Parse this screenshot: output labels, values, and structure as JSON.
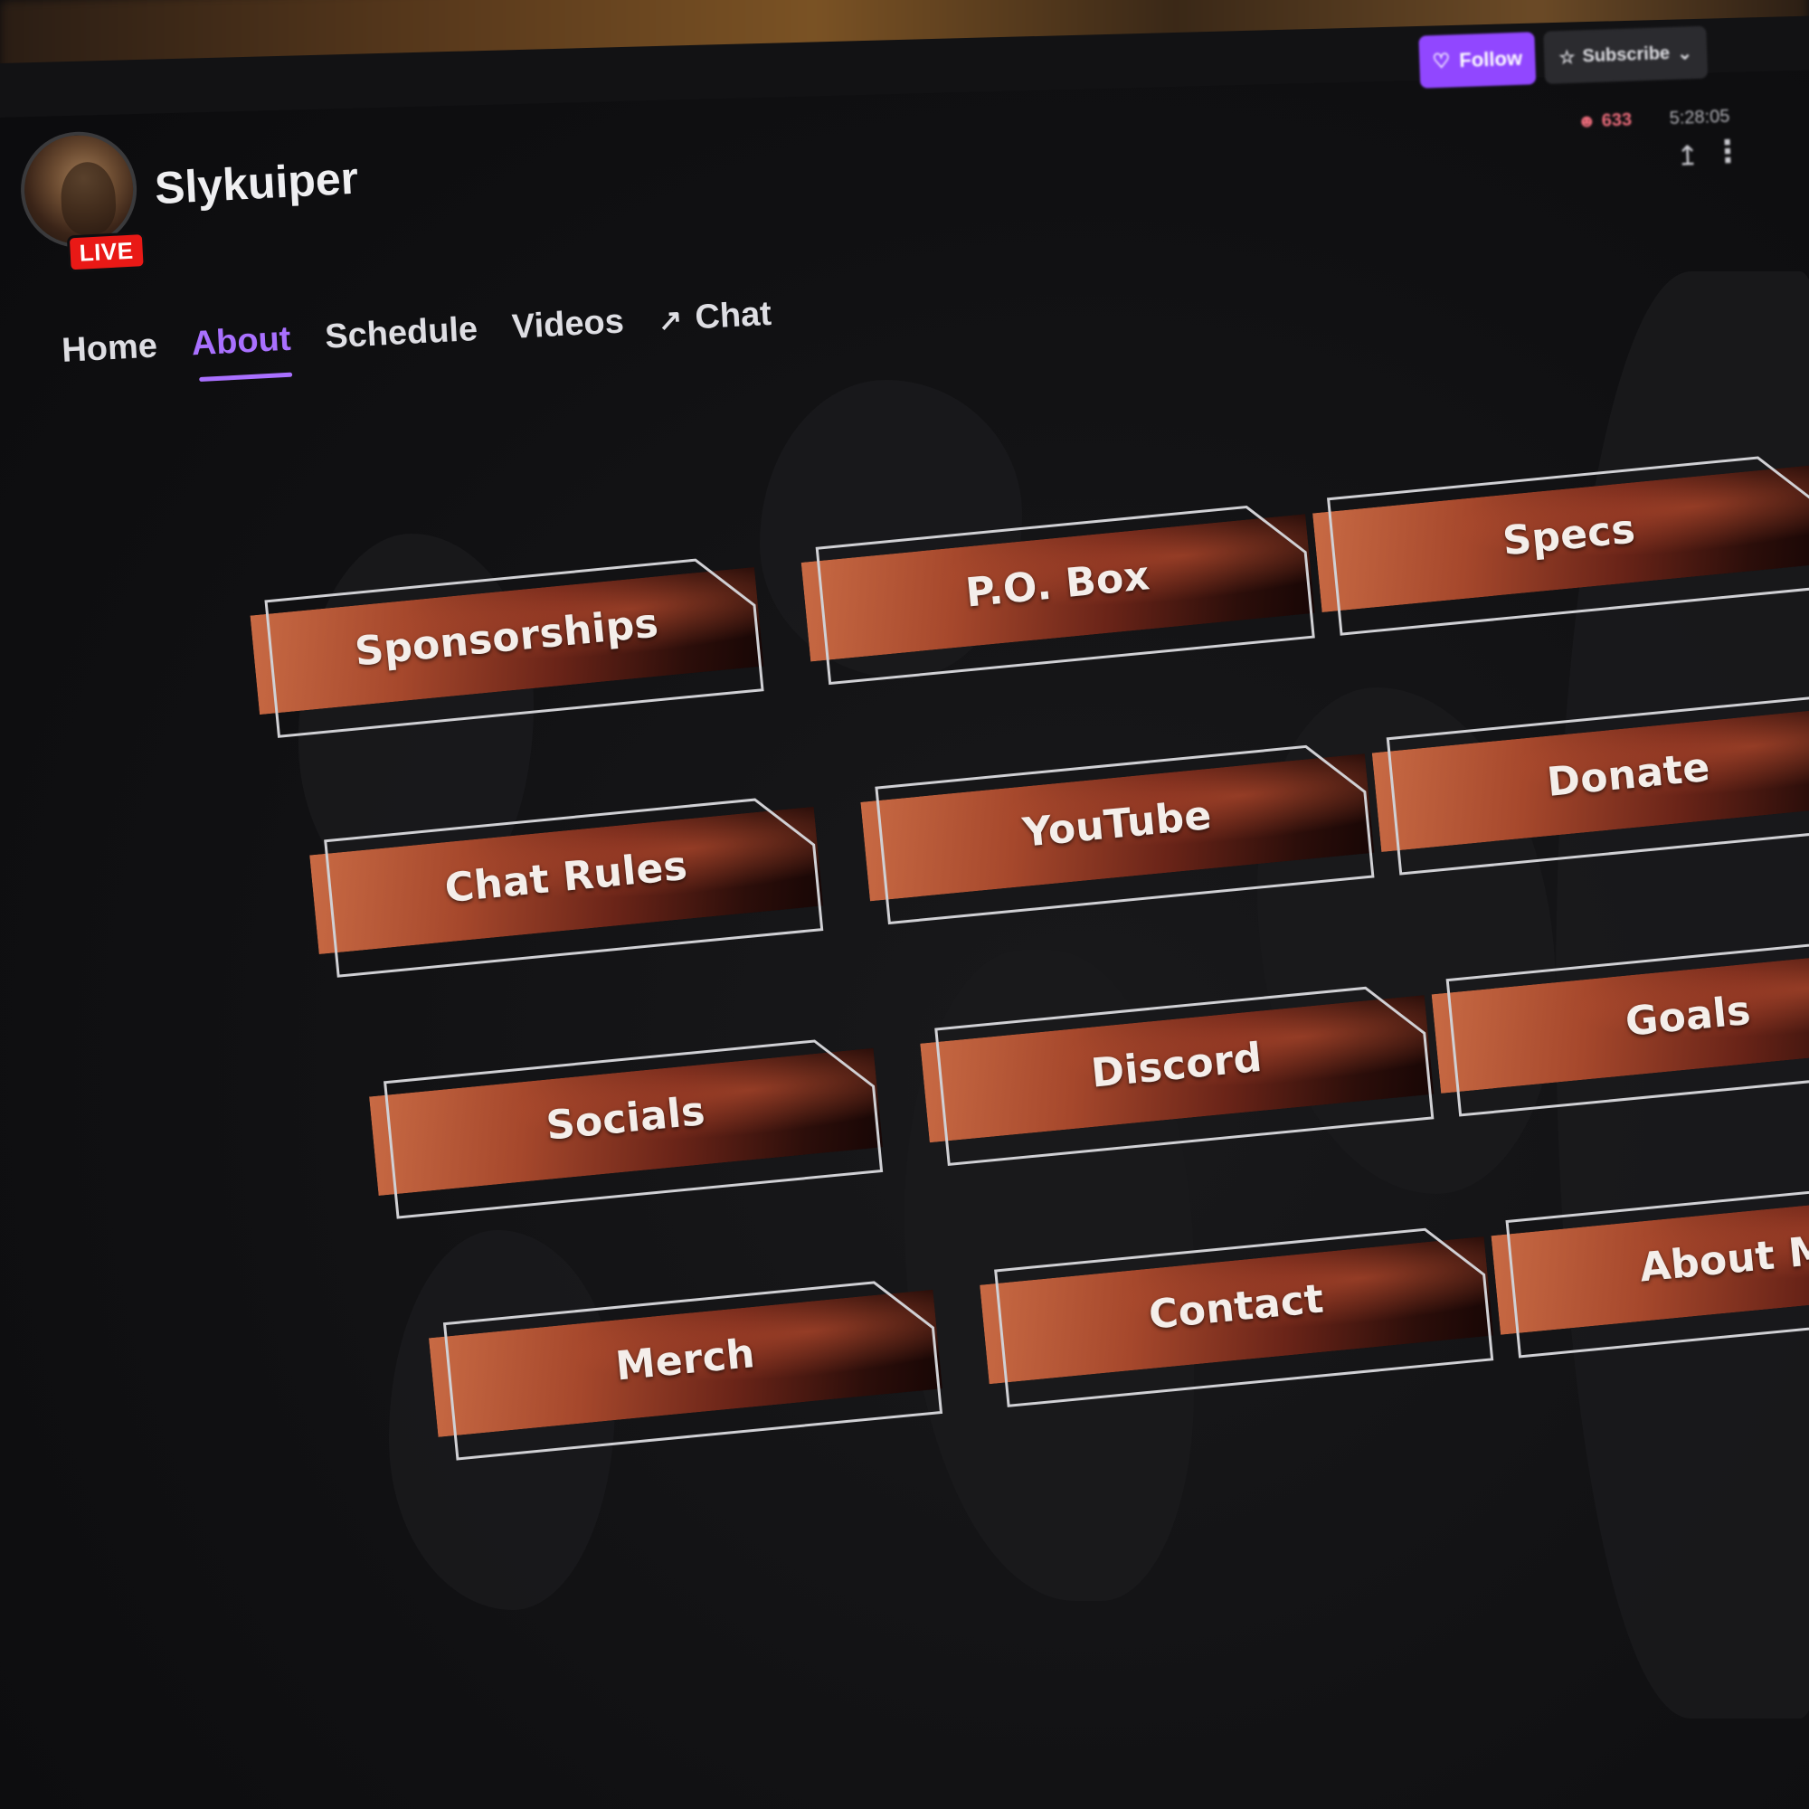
{
  "channel": {
    "name": "Slykuiper",
    "live_label": "LIVE"
  },
  "actions": {
    "follow_label": "Follow",
    "subscribe_label": "Subscribe",
    "viewer_count": "633",
    "uptime": "5:28:05"
  },
  "nav": {
    "items": [
      {
        "label": "Home"
      },
      {
        "label": "About"
      },
      {
        "label": "Schedule"
      },
      {
        "label": "Videos"
      },
      {
        "label": "Chat"
      }
    ],
    "active": "About"
  },
  "panels": [
    {
      "label": "Sponsorships"
    },
    {
      "label": "P.O. Box"
    },
    {
      "label": "Specs"
    },
    {
      "label": "Chat Rules"
    },
    {
      "label": "YouTube"
    },
    {
      "label": "Donate"
    },
    {
      "label": "Socials"
    },
    {
      "label": "Discord"
    },
    {
      "label": "Goals"
    },
    {
      "label": "Merch"
    },
    {
      "label": "Contact"
    },
    {
      "label": "About Me"
    }
  ],
  "colors": {
    "accent": "#a970ff",
    "follow": "#9147ff",
    "live": "#e91916",
    "panel_start": "#c86a44",
    "panel_end": "#170605"
  },
  "icons": {
    "follow": "heart-icon",
    "subscribe": "star-icon",
    "subscribe_dropdown": "chevron-down-icon",
    "viewers": "person-icon",
    "share": "share-icon",
    "more": "more-vertical-icon",
    "chat_popout": "arrow-up-right-icon"
  }
}
